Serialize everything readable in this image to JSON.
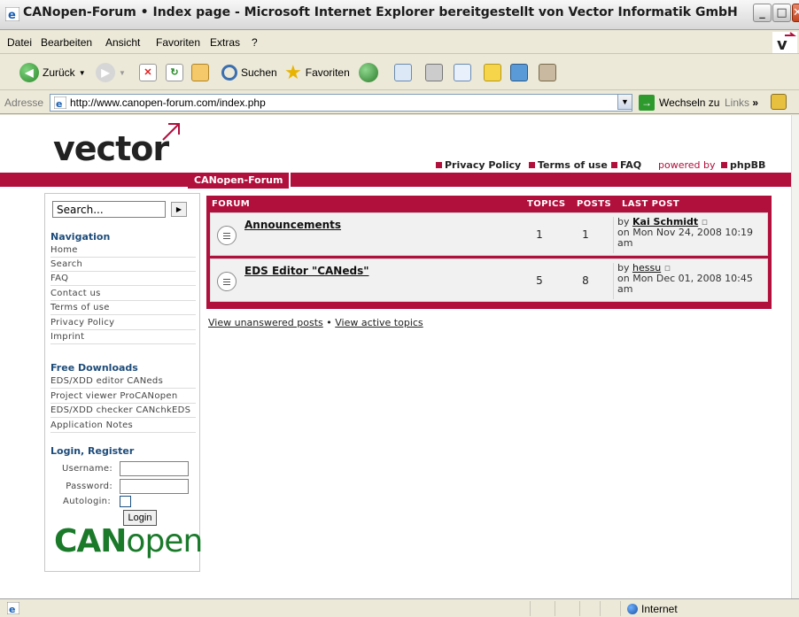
{
  "window": {
    "title": "CANopen-Forum • Index page - Microsoft Internet Explorer bereitgestellt von Vector Informatik GmbH"
  },
  "menu": [
    "Datei",
    "Bearbeiten",
    "Ansicht",
    "Favoriten",
    "Extras",
    "?"
  ],
  "toolbar": {
    "back_label": "Zurück",
    "search_label": "Suchen",
    "favorites_label": "Favoriten"
  },
  "address": {
    "label": "Adresse",
    "url": "http://www.canopen-forum.com/index.php",
    "go_label": "Wechseln zu",
    "links_label": "Links"
  },
  "site": {
    "logo_text": "vector",
    "top_links": [
      "Privacy Policy",
      "Terms of use",
      "FAQ"
    ],
    "powered_text": "powered by",
    "powered_brand": "phpBB",
    "forum_tab": "CANopen-Forum"
  },
  "sidebar": {
    "search_value": "Search...",
    "navigation_title": "Navigation",
    "navigation": [
      "Home",
      "Search",
      "FAQ",
      "Contact us",
      "Terms of use",
      "Privacy Policy",
      "Imprint"
    ],
    "downloads_title": "Free Downloads",
    "downloads": [
      "EDS/XDD editor CANeds",
      "Project viewer ProCANopen",
      "EDS/XDD checker CANchkEDS",
      "Application Notes"
    ],
    "login_title": "Login, Register",
    "username_label": "Username:",
    "password_label": "Password:",
    "autologin_label": "Autologin:",
    "login_button": "Login",
    "canopen_bold": "CAN",
    "canopen_light": "open"
  },
  "forum": {
    "headers": {
      "forum": "FORUM",
      "topics": "TOPICS",
      "posts": "POSTS",
      "last_post": "LAST POST"
    },
    "rows": [
      {
        "name": "Announcements",
        "topics": "1",
        "posts": "1",
        "by": "by",
        "user": "Kai Schmidt",
        "date": "on Mon Nov 24, 2008 10:19",
        "date2": "am"
      },
      {
        "name": "EDS Editor \"CANeds\"",
        "topics": "5",
        "posts": "8",
        "by": "by",
        "user": "hessu",
        "date": "on Mon Dec 01, 2008 10:45",
        "date2": "am"
      }
    ],
    "unanswered": "View unanswered posts",
    "separator": "•",
    "active": "View active topics"
  },
  "status": {
    "zone": "Internet"
  }
}
